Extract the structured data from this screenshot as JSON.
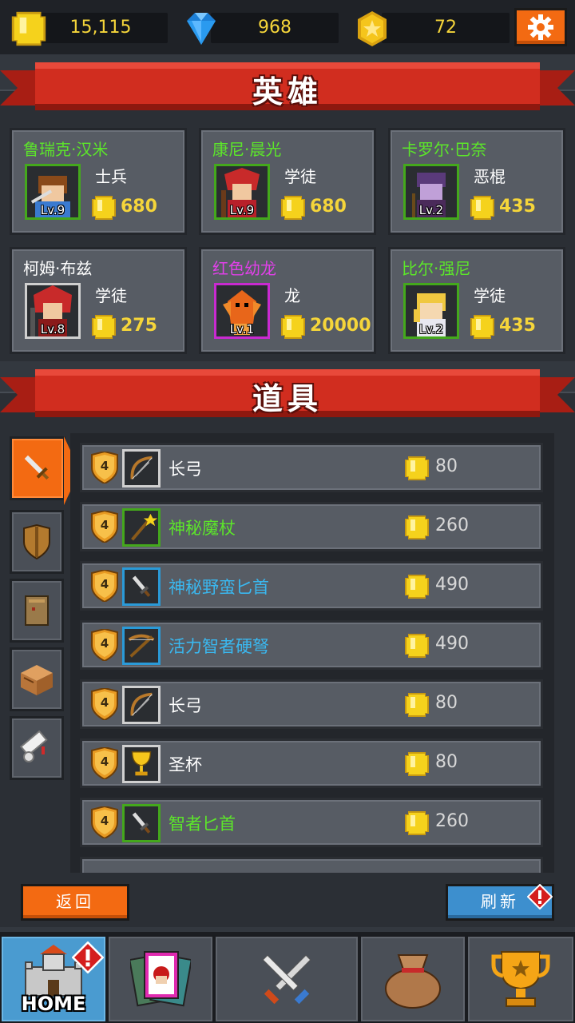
{
  "currency": {
    "gold": "15,115",
    "gems": "968",
    "medals": "72"
  },
  "heroes_section": {
    "title": "英雄",
    "heroes": [
      {
        "name": "鲁瑞克·汉米",
        "name_color": "#5ce62a",
        "class": "士兵",
        "level": "Lv.9",
        "price": "680",
        "frame": "#44a81c"
      },
      {
        "name": "康尼·晨光",
        "name_color": "#5ce62a",
        "class": "学徒",
        "level": "Lv.9",
        "price": "680",
        "frame": "#44a81c"
      },
      {
        "name": "卡罗尔·巴奈",
        "name_color": "#5ce62a",
        "class": "恶棍",
        "level": "Lv.2",
        "price": "435",
        "frame": "#44a81c"
      },
      {
        "name": "柯姆·布兹",
        "name_color": "#ffffff",
        "class": "学徒",
        "level": "Lv.8",
        "price": "275",
        "frame": "#cfcfcf"
      },
      {
        "name": "红色幼龙",
        "name_color": "#e040e8",
        "class": "龙",
        "level": "Lv.1",
        "price": "20000",
        "frame": "#c82ad0"
      },
      {
        "name": "比尔·强尼",
        "name_color": "#5ce62a",
        "class": "学徒",
        "level": "Lv.2",
        "price": "435",
        "frame": "#44a81c"
      }
    ]
  },
  "items_section": {
    "title": "道具",
    "categories": [
      "sword-icon",
      "shield-icon",
      "armor-icon",
      "chest-icon",
      "scroll-icon"
    ],
    "active_category": 0,
    "items": [
      {
        "tier": "4",
        "name": "长弓",
        "name_color": "#ffffff",
        "price": "80",
        "icon": "bow-icon",
        "frame": "#d0d0d0"
      },
      {
        "tier": "4",
        "name": "神秘魔杖",
        "name_color": "#5ce62a",
        "price": "260",
        "icon": "wand-icon",
        "frame": "#44a81c"
      },
      {
        "tier": "4",
        "name": "神秘野蛮匕首",
        "name_color": "#3ab8f0",
        "price": "490",
        "icon": "dagger-icon",
        "frame": "#2a9ad8"
      },
      {
        "tier": "4",
        "name": "活力智者硬弩",
        "name_color": "#3ab8f0",
        "price": "490",
        "icon": "crossbow-icon",
        "frame": "#2a9ad8"
      },
      {
        "tier": "4",
        "name": "长弓",
        "name_color": "#ffffff",
        "price": "80",
        "icon": "bow-icon",
        "frame": "#d0d0d0"
      },
      {
        "tier": "4",
        "name": "圣杯",
        "name_color": "#ffffff",
        "price": "80",
        "icon": "chalice-icon",
        "frame": "#d0d0d0"
      },
      {
        "tier": "4",
        "name": "智者匕首",
        "name_color": "#5ce62a",
        "price": "260",
        "icon": "dagger-icon",
        "frame": "#44a81c"
      }
    ]
  },
  "buttons": {
    "back": "返回",
    "refresh": "刷新"
  },
  "nav": {
    "home_label": "HOME",
    "items": [
      "home-castle-icon",
      "cards-icon",
      "battle-swords-icon",
      "loot-bag-icon",
      "trophy-icon"
    ]
  },
  "colors": {
    "accent_orange": "#f36a12",
    "refresh_blue": "#3d8fce",
    "coin_yellow": "#f5d53a"
  }
}
